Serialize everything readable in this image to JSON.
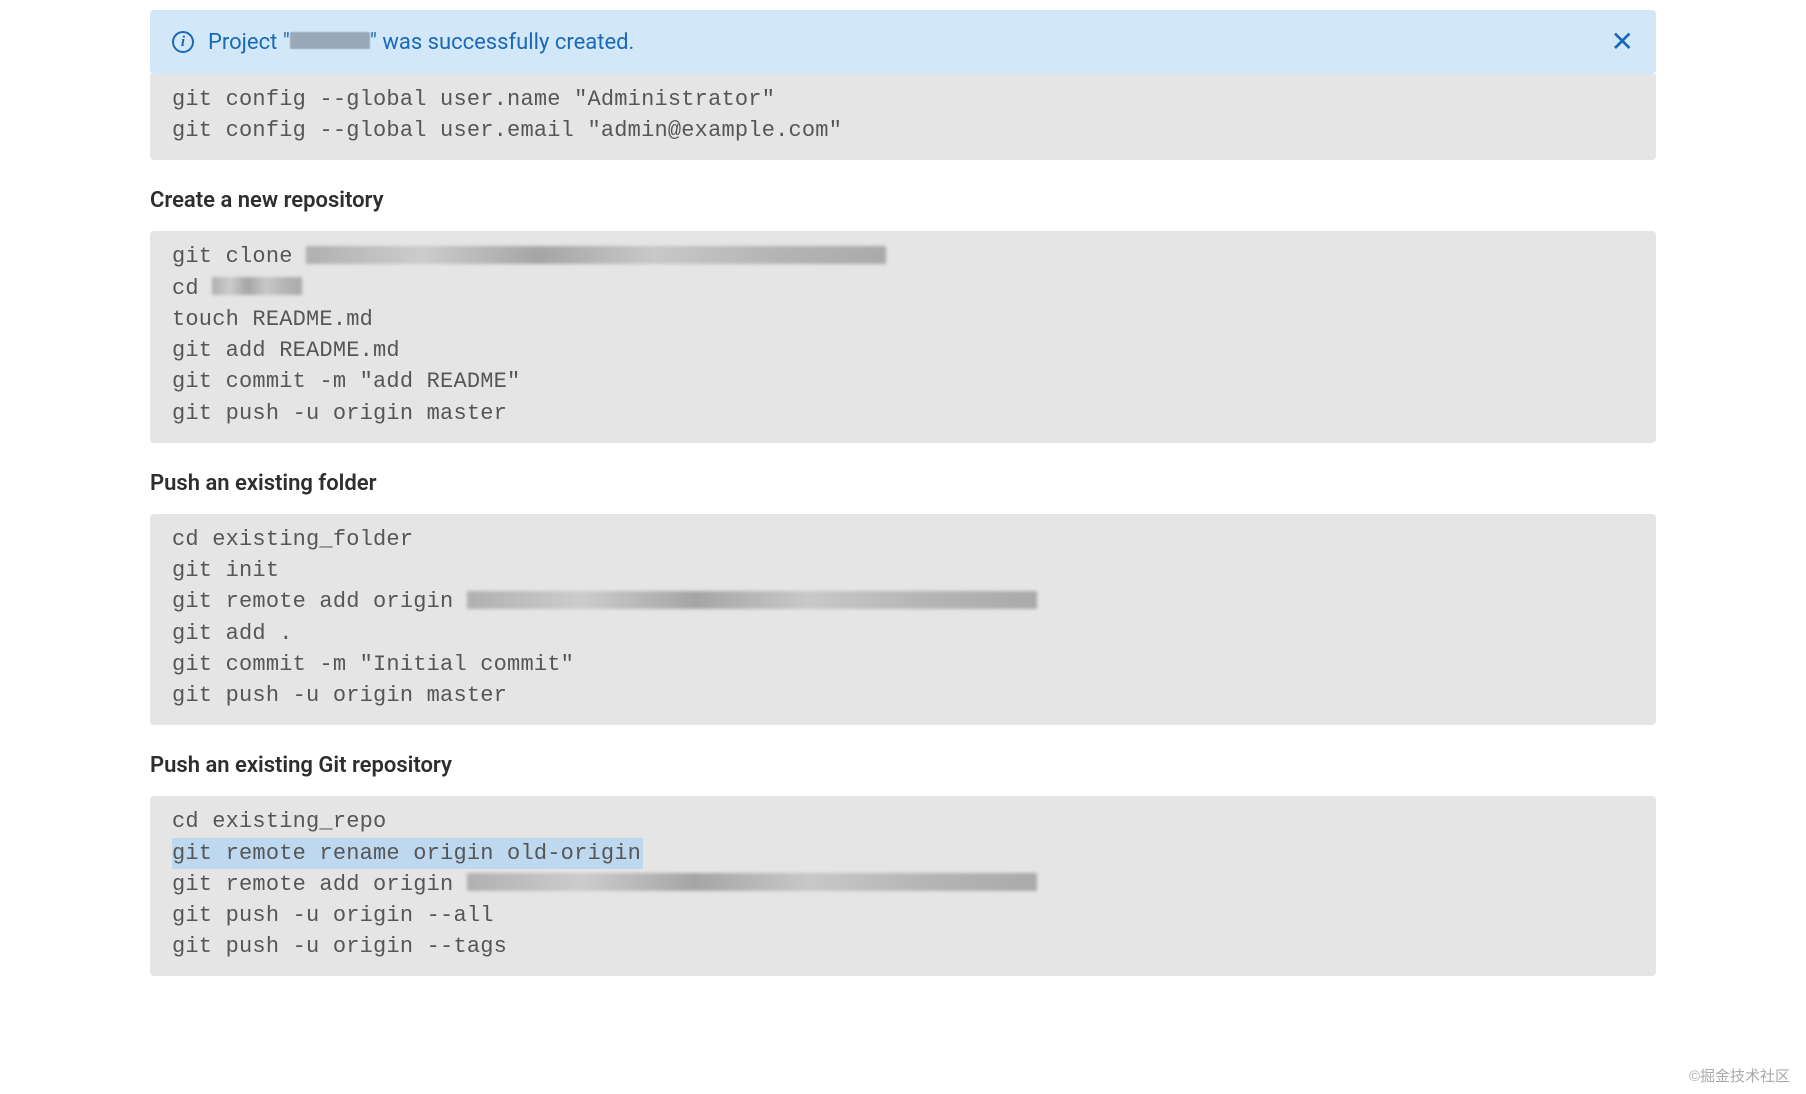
{
  "alert": {
    "text_prefix": "Project \"",
    "text_suffix": "\" was successfully created."
  },
  "sections": {
    "git_global": {
      "lines": [
        "git config --global user.name \"Administrator\"",
        "git config --global user.email \"admin@example.com\""
      ]
    },
    "create_repo": {
      "heading": "Create a new repository",
      "lines": {
        "l1_prefix": "git clone ",
        "l2_prefix": "cd ",
        "l3": "touch README.md",
        "l4": "git add README.md",
        "l5": "git commit -m \"add README\"",
        "l6": "git push -u origin master"
      }
    },
    "push_folder": {
      "heading": "Push an existing folder",
      "lines": {
        "l1": "cd existing_folder",
        "l2": "git init",
        "l3_prefix": "git remote add origin ",
        "l4": "git add .",
        "l5": "git commit -m \"Initial commit\"",
        "l6": "git push -u origin master"
      }
    },
    "push_repo": {
      "heading": "Push an existing Git repository",
      "lines": {
        "l1": "cd existing_repo",
        "l2": "git remote rename origin old-origin",
        "l3_prefix": "git remote add origin ",
        "l4": "git push -u origin --all",
        "l5": "git push -u origin --tags"
      }
    }
  },
  "watermark": "©掘金技术社区"
}
